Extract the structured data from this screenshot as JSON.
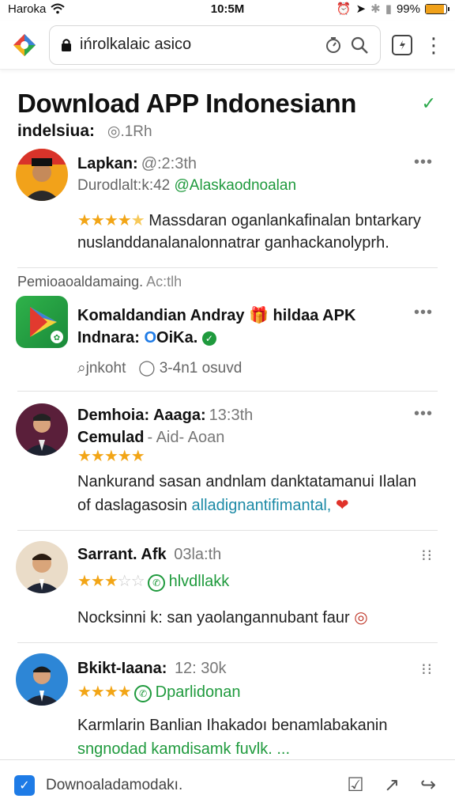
{
  "status_bar": {
    "carrier": "Haroka",
    "time": "10:5M",
    "battery": "99%",
    "battery_level": 0.9
  },
  "browser": {
    "url": "ińrolkalaic asico",
    "icons": [
      "browser-logo-icon",
      "lock-icon",
      "timer-icon",
      "search-icon",
      "tabs-icon",
      "more-icon"
    ]
  },
  "page": {
    "title": "Download APP Indonesiann",
    "subtitle": "indelsiua:",
    "subtitle_meta": "◎.1Rh"
  },
  "cards": [
    {
      "name": "Lapkan:",
      "time": "@:2:3th",
      "line2_gray": "Durodlalt:k:42",
      "line2_green": "@Alaskaodnoalan",
      "stars": 4,
      "body1": "Massdaran oganlankafinalan bntarkary",
      "body2": "nuslanddanalanalonnatrar ganhackanolyprh."
    },
    {
      "name": "Komaldandian Andray",
      "gift": "🎁",
      "title_suffix": "hildaa APK",
      "line2_name": "Indnara:",
      "line2_tag": "OiKa.",
      "meta_left": "jnkoht",
      "meta_right": "3-4n1 osuvd"
    },
    {
      "name": "Demhoia: Aaaga:",
      "time": "13:3th",
      "line2": "Cemulad",
      "line2_meta": "- Aid- Aoan",
      "stars": 5,
      "body1": "Nankurand sasan andnlam danktatamanui Ilalan",
      "body2_start": "of daslagasosin",
      "body2_teal": "alladignantifimantal,",
      "heart": "❤"
    },
    {
      "name": "Sarrant. Afk",
      "time": "03la:th",
      "line2_green": "hlvdllakk",
      "stars": 3,
      "body1": "Nocksinni k: san yaolangannubant faur"
    },
    {
      "name": "Bkikt-Iaana:",
      "time": "12: 30k",
      "line2_green": "Dparlidonan",
      "stars": 4,
      "body1": "Karmlarin Banlian Ihakadoı benamlabakanin",
      "body2_green": "sngnodad kamdisamk fuvlk. ..."
    }
  ],
  "section_label": {
    "text": "Pemioaoaldamaing.",
    "meta": "Ac:tlh"
  },
  "bottom_bar": {
    "text": "Downoaladamodakı."
  }
}
